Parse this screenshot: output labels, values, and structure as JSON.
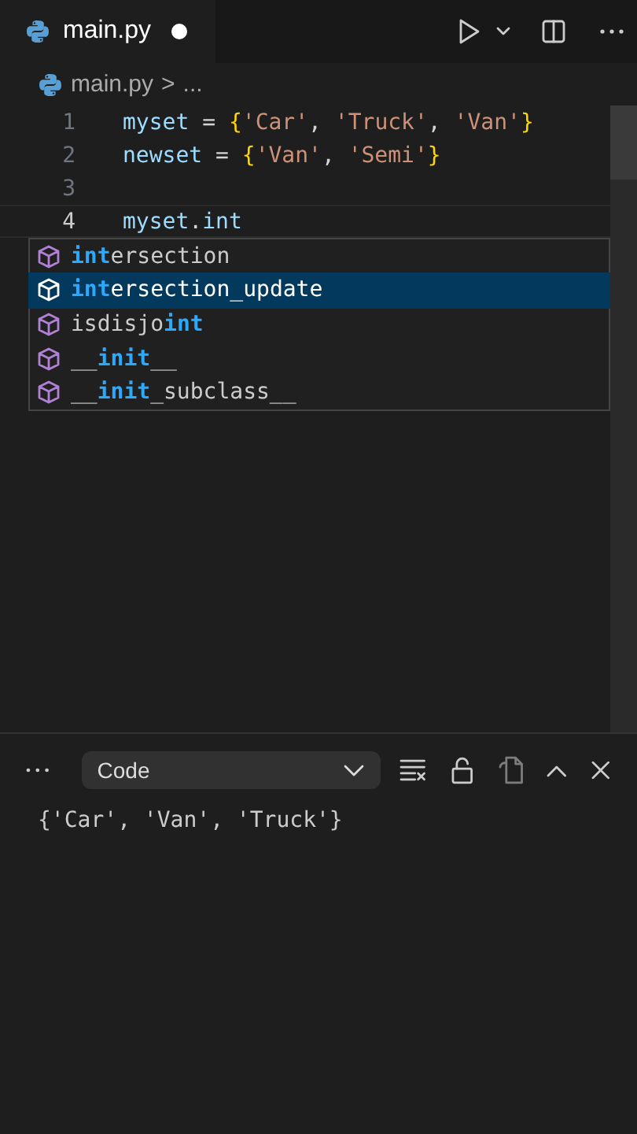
{
  "tab": {
    "title": "main.py",
    "modified": true
  },
  "breadcrumb": {
    "file": "main.py",
    "separator": ">",
    "rest": "..."
  },
  "editor": {
    "lines": [
      {
        "number": "1",
        "current": false,
        "tokens": [
          {
            "kind": "var",
            "text": "myset"
          },
          {
            "kind": "op",
            "text": " = "
          },
          {
            "kind": "brace",
            "text": "{"
          },
          {
            "kind": "string",
            "text": "'Car'"
          },
          {
            "kind": "punct",
            "text": ", "
          },
          {
            "kind": "string",
            "text": "'Truck'"
          },
          {
            "kind": "punct",
            "text": ", "
          },
          {
            "kind": "string",
            "text": "'Van'"
          },
          {
            "kind": "brace",
            "text": "}"
          }
        ]
      },
      {
        "number": "2",
        "current": false,
        "tokens": [
          {
            "kind": "var",
            "text": "newset"
          },
          {
            "kind": "op",
            "text": " = "
          },
          {
            "kind": "brace",
            "text": "{"
          },
          {
            "kind": "string",
            "text": "'Van'"
          },
          {
            "kind": "punct",
            "text": ", "
          },
          {
            "kind": "string",
            "text": "'Semi'"
          },
          {
            "kind": "brace",
            "text": "}"
          }
        ]
      },
      {
        "number": "3",
        "current": false
      },
      {
        "number": "4",
        "current": true,
        "tokens": [
          {
            "kind": "var",
            "text": "myset"
          },
          {
            "kind": "punct",
            "text": "."
          },
          {
            "kind": "var",
            "text": "int"
          }
        ]
      }
    ]
  },
  "suggestions": [
    {
      "selected": false,
      "parts": [
        {
          "text": "int",
          "match": true
        },
        {
          "text": "ersection",
          "match": false
        }
      ]
    },
    {
      "selected": true,
      "parts": [
        {
          "text": "int",
          "match": true
        },
        {
          "text": "ersection_update",
          "match": false
        }
      ]
    },
    {
      "selected": false,
      "parts": [
        {
          "text": "isdisjo",
          "match": false
        },
        {
          "text": "int",
          "match": true
        }
      ]
    },
    {
      "selected": false,
      "parts": [
        {
          "text": "__",
          "match": false
        },
        {
          "text": "init",
          "match": true
        },
        {
          "text": "__",
          "match": false
        }
      ]
    },
    {
      "selected": false,
      "parts": [
        {
          "text": "__",
          "match": false
        },
        {
          "text": "init",
          "match": true
        },
        {
          "text": "_subclass__",
          "match": false
        }
      ]
    }
  ],
  "panel": {
    "dropdown": "Code",
    "output": "{'Car', 'Van', 'Truck'}"
  }
}
